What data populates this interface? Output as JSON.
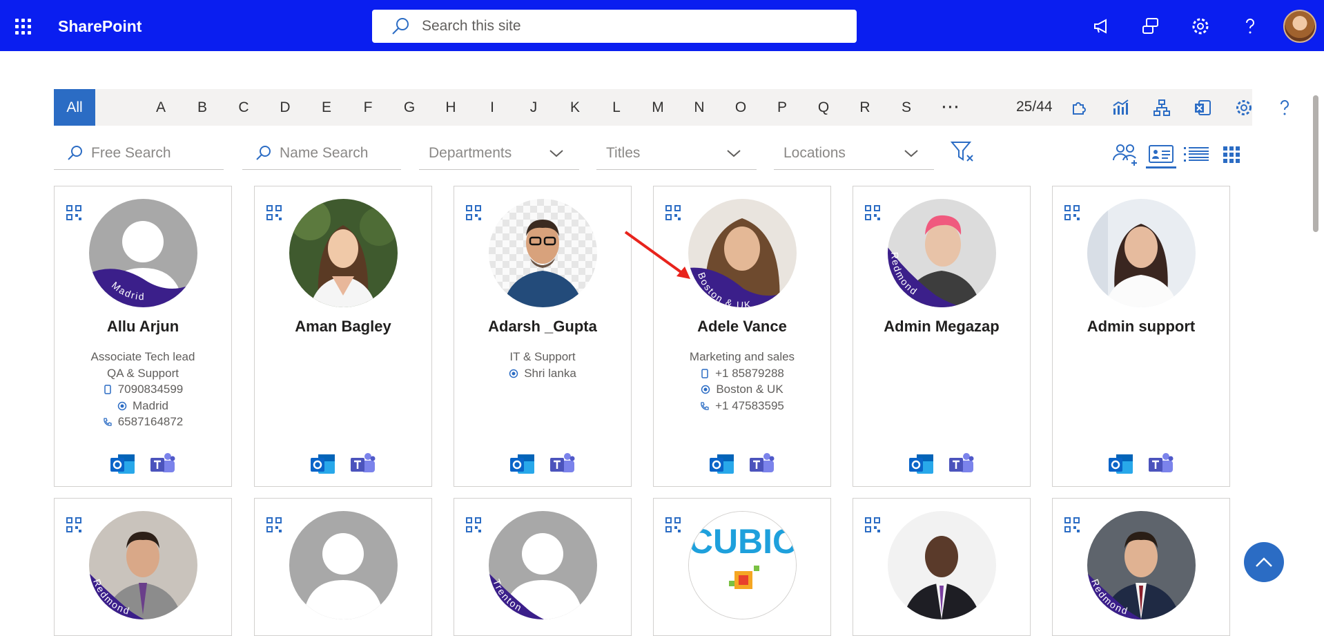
{
  "brand": "SharePoint",
  "colors": {
    "suitebar": "#0a1ef0",
    "accent": "#2b6cc4",
    "badge": "#3b1f8a"
  },
  "site_search": {
    "placeholder": "Search this site"
  },
  "top_icons": [
    "megaphone-icon",
    "feedback-icon",
    "settings-icon",
    "help-icon"
  ],
  "letters": [
    "All",
    "A",
    "B",
    "C",
    "D",
    "E",
    "F",
    "G",
    "H",
    "I",
    "J",
    "K",
    "L",
    "M",
    "N",
    "O",
    "P",
    "Q",
    "R",
    "S",
    "···"
  ],
  "active_letter": "All",
  "counter": "25/44",
  "toolbar_icons": [
    "puzzle-icon",
    "analytics-icon",
    "org-chart-icon",
    "excel-export-icon",
    "settings-icon",
    "help-icon"
  ],
  "filters": {
    "free_search": "Free Search",
    "name_search": "Name Search",
    "departments": "Departments",
    "titles": "Titles",
    "locations": "Locations"
  },
  "view_icons": [
    "group-view-icon",
    "card-view-icon",
    "list-view-icon",
    "grid-view-icon"
  ],
  "people": [
    {
      "name": "Allu Arjun",
      "badge": "Madrid",
      "photo": "placeholder",
      "lines": [
        {
          "icon": "",
          "text": "Associate Tech lead"
        },
        {
          "icon": "",
          "text": "QA & Support"
        },
        {
          "icon": "mobile",
          "text": "7090834599"
        },
        {
          "icon": "location",
          "text": "Madrid"
        },
        {
          "icon": "phone",
          "text": "6587164872"
        }
      ]
    },
    {
      "name": "Aman Bagley",
      "badge": "",
      "photo": "woman-dark-hair",
      "lines": []
    },
    {
      "name": "Adarsh _Gupta",
      "badge": "",
      "photo": "man-glasses",
      "lines": [
        {
          "icon": "",
          "text": "IT & Support"
        },
        {
          "icon": "location",
          "text": "Shri lanka"
        }
      ]
    },
    {
      "name": "Adele Vance",
      "badge": "Boston & UK",
      "photo": "woman-curly",
      "lines": [
        {
          "icon": "",
          "text": "Marketing and sales"
        },
        {
          "icon": "mobile",
          "text": "+1 85879288"
        },
        {
          "icon": "location",
          "text": "Boston & UK"
        },
        {
          "icon": "phone",
          "text": "+1 47583595"
        }
      ]
    },
    {
      "name": "Admin Megazap",
      "badge": "Redmond",
      "photo": "man-pink-hair",
      "lines": []
    },
    {
      "name": "Admin support",
      "badge": "",
      "photo": "woman-white-shirt",
      "lines": []
    }
  ],
  "people_row2": [
    {
      "badge": "Redmond",
      "photo": "man-tie"
    },
    {
      "badge": "",
      "photo": "placeholder"
    },
    {
      "badge": "Trenton",
      "photo": "placeholder"
    },
    {
      "badge": "",
      "photo": "logo",
      "logo_text": "CUBIC"
    },
    {
      "badge": "",
      "photo": "man-suit-purple"
    },
    {
      "badge": "Redmond",
      "photo": "man-navy-suit"
    }
  ]
}
